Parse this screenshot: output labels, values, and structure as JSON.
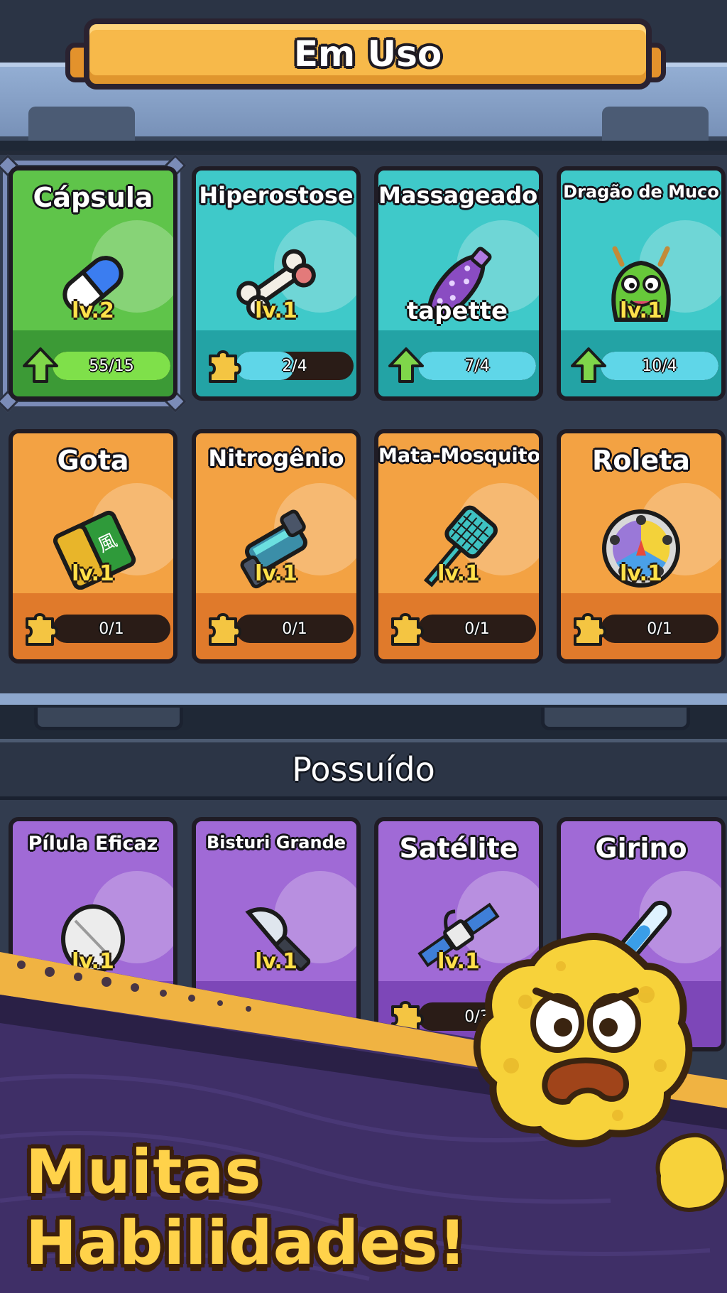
{
  "header": {
    "title": "Em Uso"
  },
  "equipped_label_overlay": "tapette",
  "equipped": [
    {
      "name": "Cápsula",
      "level": "lv.2",
      "progress_text": "55/15",
      "progress": 1.0,
      "theme": "green",
      "upgrade_ready": true,
      "icon": "capsule-pill-icon",
      "selected": true
    },
    {
      "name": "Hiperostose",
      "level": "lv.1",
      "progress_text": "2/4",
      "progress": 0.5,
      "theme": "teal",
      "upgrade_ready": false,
      "icon": "bone-icon"
    },
    {
      "name": "Massageador",
      "level": "",
      "progress_text": "7/4",
      "progress": 1.0,
      "theme": "teal",
      "upgrade_ready": true,
      "icon": "spiked-massager-icon"
    },
    {
      "name": "Dragão de Muco",
      "level": "lv.1",
      "progress_text": "10/4",
      "progress": 1.0,
      "theme": "teal",
      "upgrade_ready": true,
      "icon": "mucus-dragon-icon"
    },
    {
      "name": "Gota",
      "level": "lv.1",
      "progress_text": "0/1",
      "progress": 0,
      "theme": "orange",
      "upgrade_ready": false,
      "icon": "medicine-box-icon"
    },
    {
      "name": "Nitrogênio",
      "level": "lv.1",
      "progress_text": "0/1",
      "progress": 0,
      "theme": "orange",
      "upgrade_ready": false,
      "icon": "nitrogen-device-icon"
    },
    {
      "name": "Mata-Mosquito",
      "level": "lv.1",
      "progress_text": "0/1",
      "progress": 0,
      "theme": "orange",
      "upgrade_ready": false,
      "icon": "fly-swatter-icon"
    },
    {
      "name": "Roleta",
      "level": "lv.1",
      "progress_text": "0/1",
      "progress": 0,
      "theme": "orange",
      "upgrade_ready": false,
      "icon": "roulette-wheel-icon"
    }
  ],
  "owned_section": {
    "title": "Possuído"
  },
  "owned": [
    {
      "name": "Pílula Eficaz",
      "level": "lv.1",
      "theme": "purple",
      "icon": "round-pill-icon"
    },
    {
      "name": "Bisturi Grande",
      "level": "lv.1",
      "theme": "purple",
      "icon": "scalpel-icon"
    },
    {
      "name": "Satélite",
      "level": "lv.1",
      "progress_text": "0/3",
      "theme": "purple",
      "icon": "satellite-icon"
    },
    {
      "name": "Girino",
      "level": "",
      "theme": "purple",
      "icon": "test-tube-icon"
    }
  ],
  "promo": {
    "title": "Muitas Habilidades!",
    "mascot": "angry-germ-mascot-icon"
  },
  "colors": {
    "banner": "#f7b94a",
    "panel": "#323c4f",
    "green": "#5fc44a",
    "teal": "#3fc9c9",
    "orange": "#f3a243",
    "purple": "#a06ad6",
    "level_text": "#ffe14a",
    "upgrade_arrow": "#7fd64a"
  }
}
